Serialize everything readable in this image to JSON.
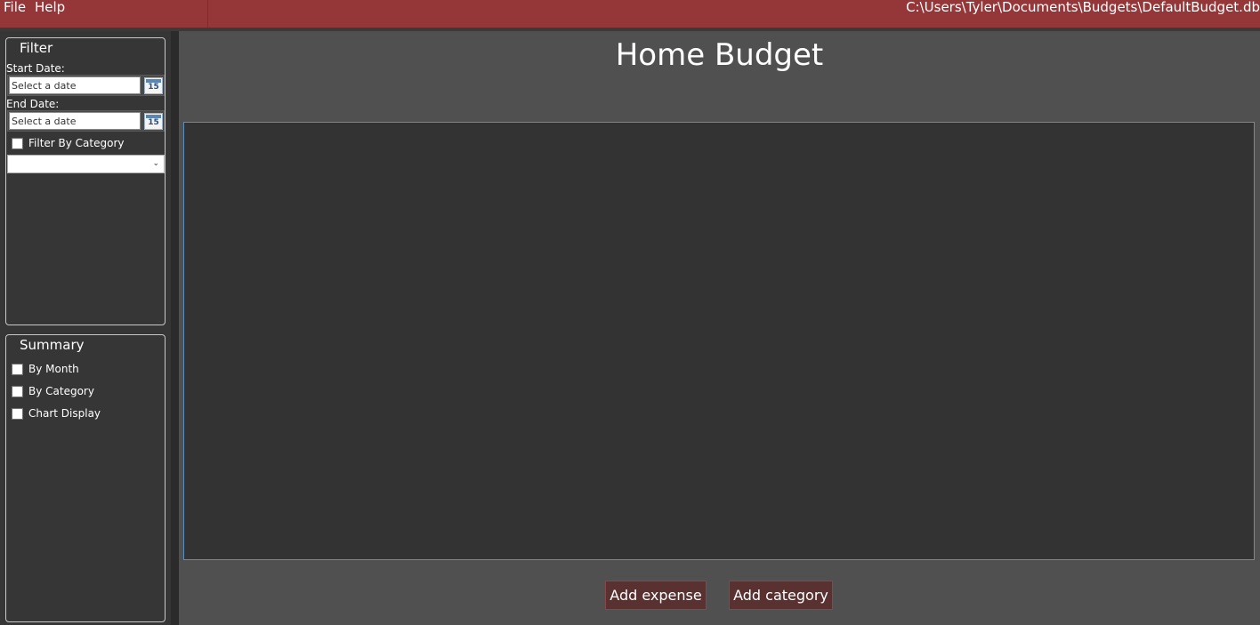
{
  "menu": {
    "file": "File",
    "help": "Help"
  },
  "file_path": "C:\\Users\\Tyler\\Documents\\Budgets\\DefaultBudget.db",
  "filter": {
    "header": "Filter",
    "start_date_label": "Start Date:",
    "start_date_placeholder": "Select a date",
    "end_date_label": "End Date:",
    "end_date_placeholder": "Select a date",
    "calendar_day": "15",
    "filter_by_category_label": "Filter By Category",
    "category_selected": ""
  },
  "summary": {
    "header": "Summary",
    "by_month_label": "By Month",
    "by_category_label": "By Category",
    "chart_display_label": "Chart Display"
  },
  "main": {
    "title": "Home Budget",
    "add_expense_label": "Add expense",
    "add_category_label": "Add category"
  },
  "colors": {
    "menubar": "#953739",
    "button_bg": "#5a3131",
    "grid_border": "#5d8fbd",
    "main_bg": "#505050"
  }
}
